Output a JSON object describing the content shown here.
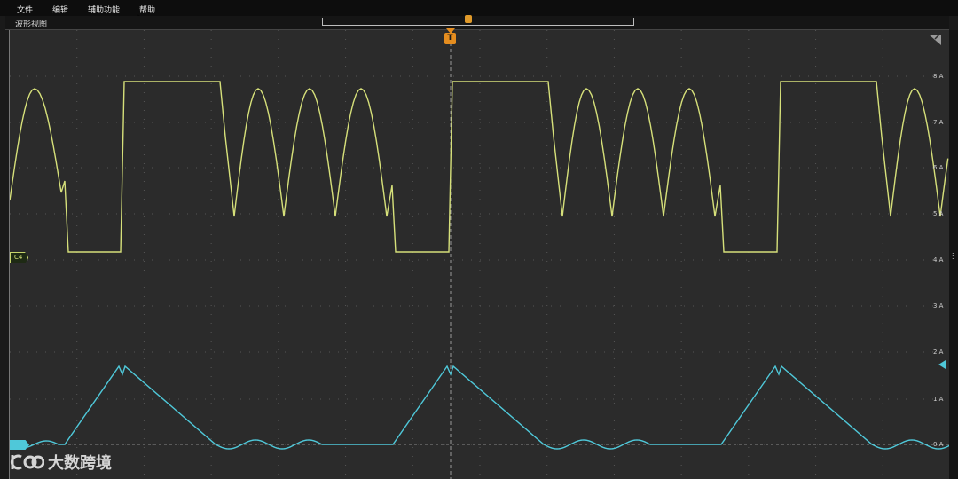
{
  "menu": {
    "items": [
      {
        "id": "file",
        "label": "文件"
      },
      {
        "id": "edit",
        "label": "编辑"
      },
      {
        "id": "utility",
        "label": "辅助功能"
      },
      {
        "id": "help",
        "label": "帮助"
      }
    ]
  },
  "panel": {
    "title": "波形视图"
  },
  "trigger": {
    "badge_label": "T",
    "color": "#e58d1f"
  },
  "channels": {
    "c4": {
      "label": "C4",
      "color": "#d6e07a"
    },
    "c2": {
      "label": "",
      "color": "#4fc8d9"
    }
  },
  "axis": {
    "labels": [
      "8 A",
      "7 A",
      "6 A",
      "5 A",
      "4 A",
      "3 A",
      "2 A",
      "1 A",
      "0 A"
    ]
  },
  "watermark": {
    "text": "大数跨境"
  },
  "icons": {
    "corner": "zoom-corner-icon",
    "cursor": "mouse-pointer-icon"
  }
}
